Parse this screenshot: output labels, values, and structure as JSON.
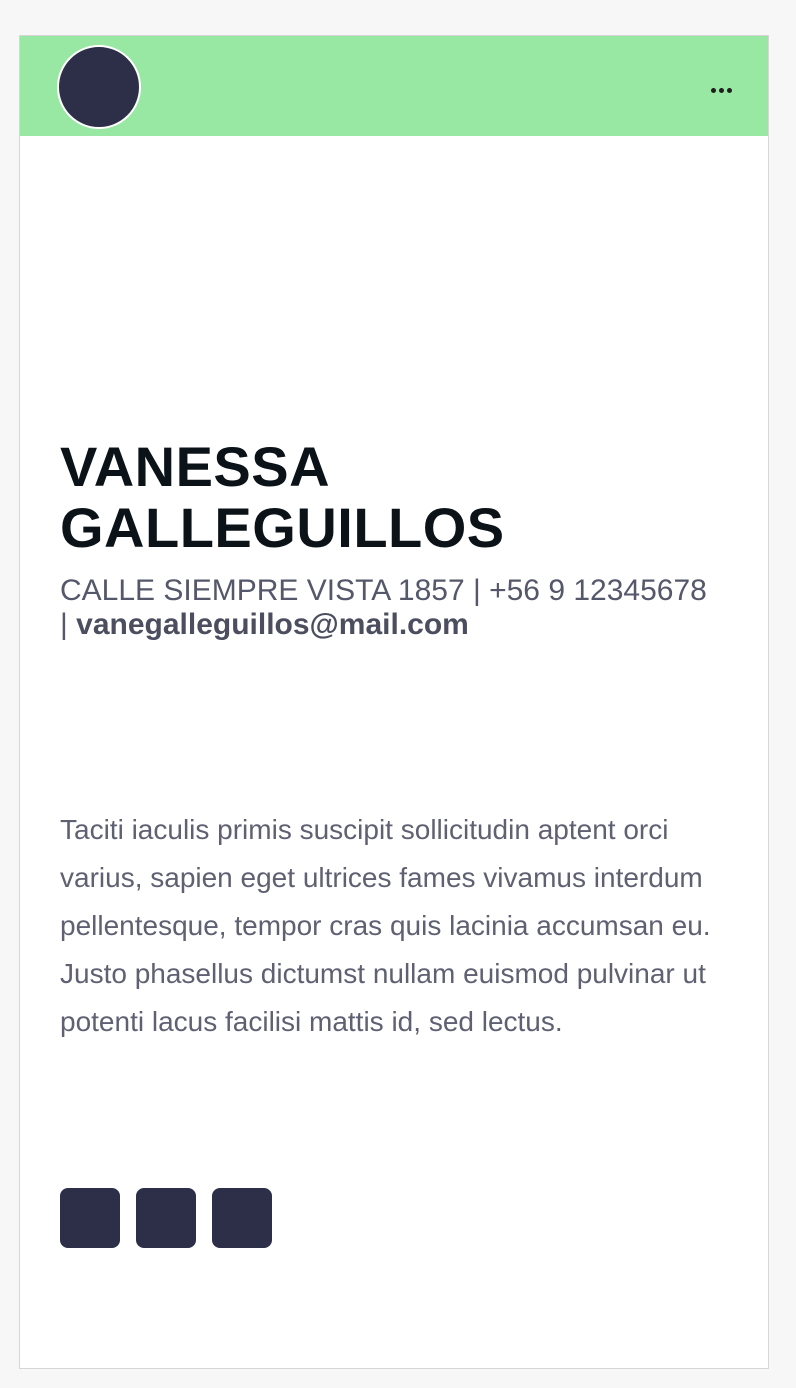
{
  "header": {
    "background_color": "#98e8a4",
    "avatar_color": "#2c2f47",
    "menu_icon": "more-horizontal-icon"
  },
  "profile": {
    "name_line1": "VANESSA",
    "name_line2": "GALLEGUILLOS",
    "address_phone": "CALLE SIEMPRE VISTA 1857 | +56 9 12345678",
    "separator": "| ",
    "email": "vanegalleguillos@mail.com"
  },
  "bio": {
    "text": "Taciti iaculis primis suscipit sollicitudin aptent orci varius, sapien eget ultrices fames vivamus interdum pellentesque, tempor cras quis lacinia accumsan eu. Justo phasellus dictumst nullam euismod pulvinar ut potenti lacus facilisi mattis id, sed lectus."
  },
  "social_links": [
    {
      "icon": "social-icon-1",
      "color": "#2c2f47"
    },
    {
      "icon": "social-icon-2",
      "color": "#2c2f47"
    },
    {
      "icon": "social-icon-3",
      "color": "#2c2f47"
    }
  ]
}
